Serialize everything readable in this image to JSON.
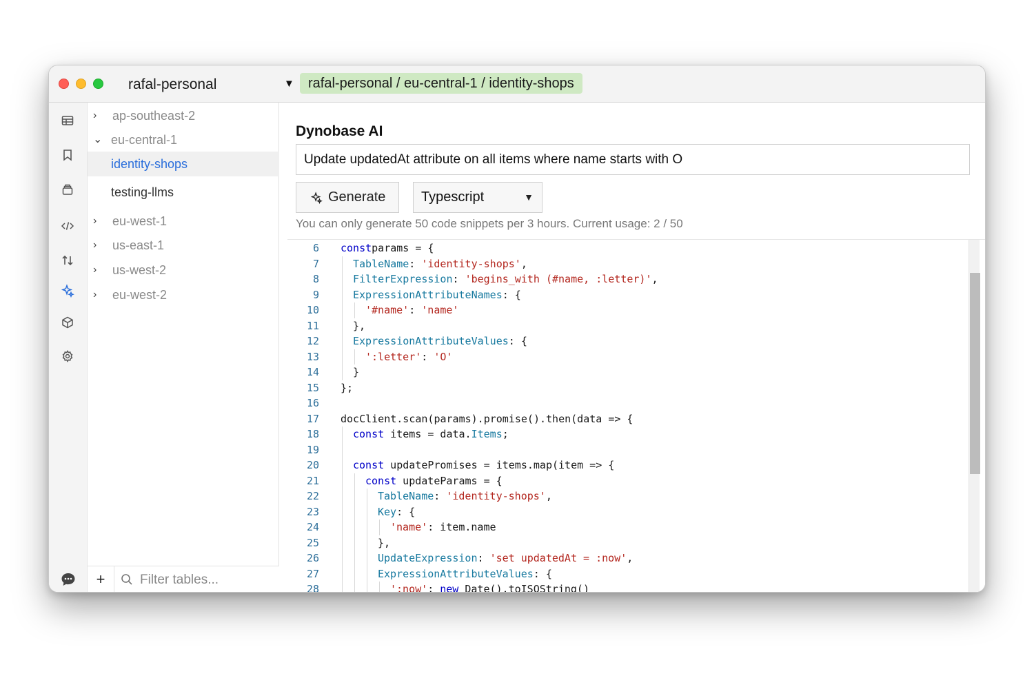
{
  "window": {
    "profile": "rafal-personal",
    "breadcrumb": "rafal-personal / eu-central-1 / identity-shops"
  },
  "rail_icons": [
    "table-icon",
    "bookmark-icon",
    "database-icon",
    "code-icon",
    "transfer-icon",
    "sparkle-icon",
    "cube-icon",
    "gear-icon",
    "chat-icon"
  ],
  "tree": {
    "regions": [
      {
        "label": "ap-southeast-2",
        "expanded": false
      },
      {
        "label": "eu-central-1",
        "expanded": true
      },
      {
        "label": "eu-west-1",
        "expanded": false
      },
      {
        "label": "us-east-1",
        "expanded": false
      },
      {
        "label": "us-west-2",
        "expanded": false
      },
      {
        "label": "eu-west-2",
        "expanded": false
      }
    ],
    "tables": [
      "identity-shops",
      "testing-llms"
    ],
    "selected": "identity-shops"
  },
  "filter": {
    "add_label": "+",
    "placeholder": "Filter tables..."
  },
  "ai": {
    "title": "Dynobase AI",
    "prompt_value": "Update updatedAt attribute on all items where name starts with O",
    "generate_label": "Generate",
    "language": "Typescript",
    "usage_note": "You can only generate 50 code snippets per 3 hours. Current usage: 2 / 50"
  },
  "code": {
    "lines": [
      {
        "n": "6",
        "indent": 0,
        "tokens": [
          [
            "kw",
            "const"
          ],
          [
            "",
            "params = {"
          ]
        ]
      },
      {
        "n": "7",
        "indent": 1,
        "tokens": [
          [
            "prop",
            "TableName"
          ],
          [
            "",
            ": "
          ],
          [
            "str",
            "'identity-shops'"
          ],
          [
            "",
            ","
          ]
        ]
      },
      {
        "n": "8",
        "indent": 1,
        "tokens": [
          [
            "prop",
            "FilterExpression"
          ],
          [
            "",
            ": "
          ],
          [
            "str",
            "'begins_with (#name, :letter)'"
          ],
          [
            "",
            ","
          ]
        ]
      },
      {
        "n": "9",
        "indent": 1,
        "tokens": [
          [
            "prop",
            "ExpressionAttributeNames"
          ],
          [
            "",
            ": {"
          ]
        ]
      },
      {
        "n": "10",
        "indent": 2,
        "tokens": [
          [
            "str",
            "'#name'"
          ],
          [
            "",
            ": "
          ],
          [
            "str",
            "'name'"
          ]
        ]
      },
      {
        "n": "11",
        "indent": 1,
        "tokens": [
          [
            "",
            "},"
          ]
        ]
      },
      {
        "n": "12",
        "indent": 1,
        "tokens": [
          [
            "prop",
            "ExpressionAttributeValues"
          ],
          [
            "",
            ": {"
          ]
        ]
      },
      {
        "n": "13",
        "indent": 2,
        "tokens": [
          [
            "str",
            "':letter'"
          ],
          [
            "",
            ": "
          ],
          [
            "str",
            "'O'"
          ]
        ]
      },
      {
        "n": "14",
        "indent": 1,
        "tokens": [
          [
            "",
            "}"
          ]
        ]
      },
      {
        "n": "15",
        "indent": 0,
        "tokens": [
          [
            "",
            "};"
          ]
        ]
      },
      {
        "n": "16",
        "indent": 0,
        "tokens": []
      },
      {
        "n": "17",
        "indent": 0,
        "tokens": [
          [
            "",
            "docClient.scan(params).promise().then(data => {"
          ]
        ]
      },
      {
        "n": "18",
        "indent": 1,
        "tokens": [
          [
            "kw",
            "const"
          ],
          [
            "",
            " items = data."
          ],
          [
            "prop",
            "Items"
          ],
          [
            "",
            ";"
          ]
        ]
      },
      {
        "n": "19",
        "indent": 1,
        "tokens": []
      },
      {
        "n": "20",
        "indent": 1,
        "tokens": [
          [
            "kw",
            "const"
          ],
          [
            "",
            " updatePromises = items.map(item => {"
          ]
        ]
      },
      {
        "n": "21",
        "indent": 2,
        "tokens": [
          [
            "kw",
            "const"
          ],
          [
            "",
            " updateParams = {"
          ]
        ]
      },
      {
        "n": "22",
        "indent": 3,
        "tokens": [
          [
            "prop",
            "TableName"
          ],
          [
            "",
            ": "
          ],
          [
            "str",
            "'identity-shops'"
          ],
          [
            "",
            ","
          ]
        ]
      },
      {
        "n": "23",
        "indent": 3,
        "tokens": [
          [
            "prop",
            "Key"
          ],
          [
            "",
            ": {"
          ]
        ]
      },
      {
        "n": "24",
        "indent": 4,
        "tokens": [
          [
            "str",
            "'name'"
          ],
          [
            "",
            ": item.name"
          ]
        ]
      },
      {
        "n": "25",
        "indent": 3,
        "tokens": [
          [
            "",
            "},"
          ]
        ]
      },
      {
        "n": "26",
        "indent": 3,
        "tokens": [
          [
            "prop",
            "UpdateExpression"
          ],
          [
            "",
            ": "
          ],
          [
            "str",
            "'set updatedAt = :now'"
          ],
          [
            "",
            ","
          ]
        ]
      },
      {
        "n": "27",
        "indent": 3,
        "tokens": [
          [
            "prop",
            "ExpressionAttributeValues"
          ],
          [
            "",
            ": {"
          ]
        ]
      },
      {
        "n": "28",
        "indent": 4,
        "tokens": [
          [
            "str",
            "':now'"
          ],
          [
            "",
            ": "
          ],
          [
            "kw",
            "new"
          ],
          [
            "",
            " Date().toISOString()"
          ]
        ]
      }
    ]
  },
  "colors": {
    "accent": "#2a6edb",
    "breadcrumb_bg": "#cfe9c3",
    "keyword": "#0000c8",
    "property": "#17799f",
    "string": "#b3261e"
  }
}
